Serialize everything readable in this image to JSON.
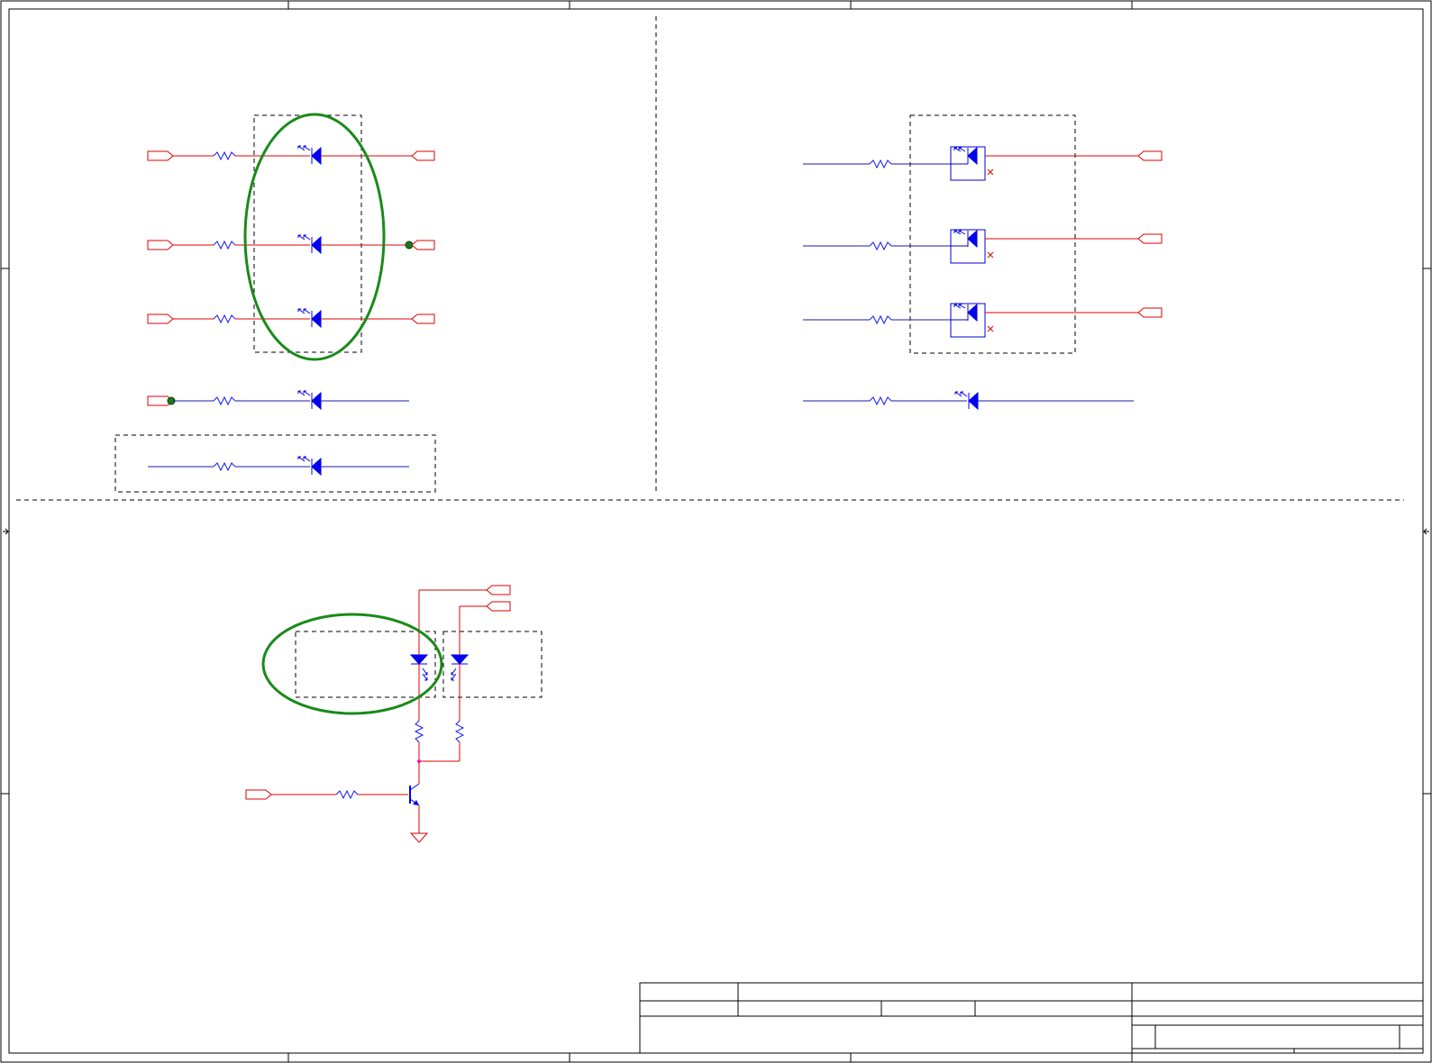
{
  "title_block": {
    "title": "",
    "drawing_number": "",
    "revision": "",
    "sheet": ""
  },
  "colors": {
    "wire": "#e00000",
    "net_wire": "#1a1aa8",
    "component": "#0000ee",
    "highlight": "#1a8a1a",
    "frame": "#000000"
  },
  "icons": [
    "led-icon",
    "resistor-icon",
    "npn-transistor-icon",
    "ground-icon",
    "port-icon"
  ]
}
